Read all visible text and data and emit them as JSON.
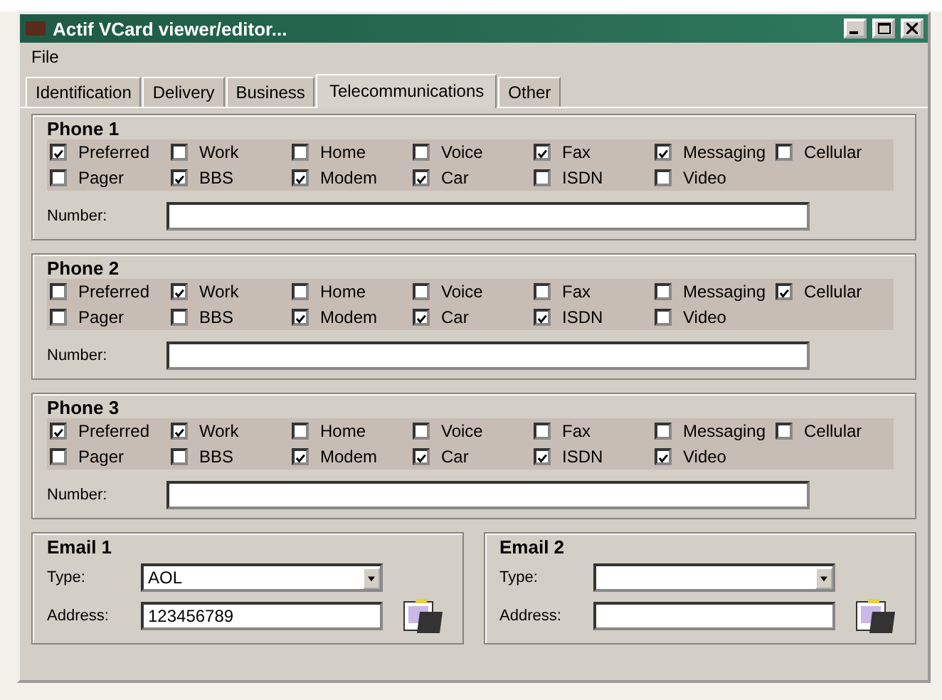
{
  "window": {
    "title": "Actif VCard viewer/editor..."
  },
  "menu": [
    {
      "label": "File"
    }
  ],
  "tabs": [
    {
      "label": "Identification",
      "selected": false
    },
    {
      "label": "Delivery",
      "selected": false
    },
    {
      "label": "Business",
      "selected": false
    },
    {
      "label": "Telecommunications",
      "selected": true
    },
    {
      "label": "Other",
      "selected": false
    }
  ],
  "phones": [
    {
      "title": "Phone 1",
      "number_label": "Number:",
      "options": [
        {
          "label": "Preferred",
          "checked": true
        },
        {
          "label": "Work",
          "checked": false
        },
        {
          "label": "Home",
          "checked": false
        },
        {
          "label": "Voice",
          "checked": false
        },
        {
          "label": "Fax",
          "checked": true
        },
        {
          "label": "Messaging",
          "checked": true
        },
        {
          "label": "Cellular",
          "checked": false
        },
        {
          "label": "Pager",
          "checked": false
        },
        {
          "label": "BBS",
          "checked": true
        },
        {
          "label": "Modem",
          "checked": true
        },
        {
          "label": "Car",
          "checked": true
        },
        {
          "label": "ISDN",
          "checked": false
        },
        {
          "label": "Video",
          "checked": false
        }
      ]
    },
    {
      "title": "Phone 2",
      "number_label": "Number:",
      "options": [
        {
          "label": "Preferred",
          "checked": false
        },
        {
          "label": "Work",
          "checked": true
        },
        {
          "label": "Home",
          "checked": false
        },
        {
          "label": "Voice",
          "checked": false
        },
        {
          "label": "Fax",
          "checked": false
        },
        {
          "label": "Messaging",
          "checked": false
        },
        {
          "label": "Cellular",
          "checked": true
        },
        {
          "label": "Pager",
          "checked": false
        },
        {
          "label": "BBS",
          "checked": false
        },
        {
          "label": "Modem",
          "checked": true
        },
        {
          "label": "Car",
          "checked": true
        },
        {
          "label": "ISDN",
          "checked": true
        },
        {
          "label": "Video",
          "checked": false
        }
      ]
    },
    {
      "title": "Phone 3",
      "number_label": "Number:",
      "options": [
        {
          "label": "Preferred",
          "checked": true
        },
        {
          "label": "Work",
          "checked": true
        },
        {
          "label": "Home",
          "checked": false
        },
        {
          "label": "Voice",
          "checked": false
        },
        {
          "label": "Fax",
          "checked": false
        },
        {
          "label": "Messaging",
          "checked": false
        },
        {
          "label": "Cellular",
          "checked": false
        },
        {
          "label": "Pager",
          "checked": false
        },
        {
          "label": "BBS",
          "checked": false
        },
        {
          "label": "Modem",
          "checked": true
        },
        {
          "label": "Car",
          "checked": true
        },
        {
          "label": "ISDN",
          "checked": true
        },
        {
          "label": "Video",
          "checked": true
        }
      ]
    }
  ],
  "emails": [
    {
      "title": "Email 1",
      "type_label": "Type:",
      "type": "AOL",
      "address_label": "Address:",
      "address": "123456789"
    },
    {
      "title": "Email 2",
      "type_label": "Type:",
      "address_label": "Address:"
    }
  ]
}
